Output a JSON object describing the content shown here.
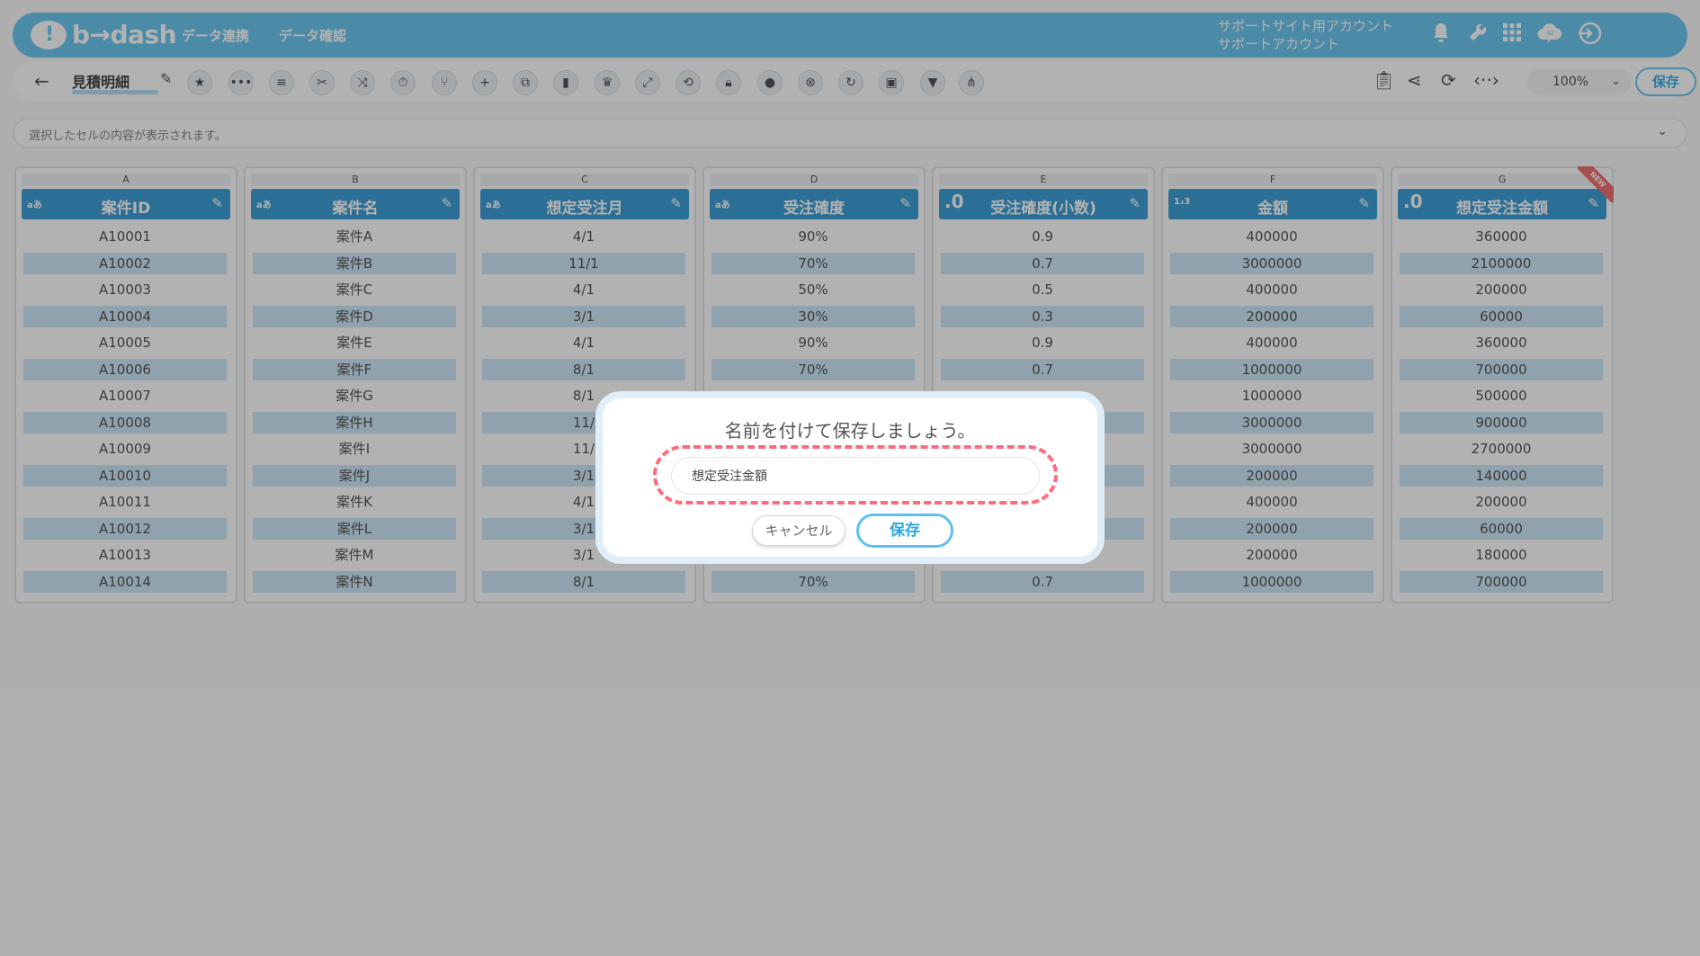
{
  "header": {
    "logo_text": "b→dash",
    "nav": [
      "データ連携",
      "データ確認"
    ],
    "account_line1": "サポートサイト用アカウント",
    "account_line2": "サポートアカウント",
    "icons": [
      "bell-icon",
      "wrench-icon",
      "grid-icon",
      "cloud-icon",
      "logout-icon"
    ],
    "cloud_badge": "32",
    "accent": "#6ec8ef"
  },
  "toolbar": {
    "back": "←",
    "sheet_title": "見積明細",
    "zoom": "100%",
    "save_label": "保存"
  },
  "cellbar": {
    "placeholder": "選択したセルの内容が表示されます。"
  },
  "columns": [
    {
      "letter": "A",
      "type": "aあ",
      "name": "案件ID",
      "values": [
        "A10001",
        "A10002",
        "A10003",
        "A10004",
        "A10005",
        "A10006",
        "A10007",
        "A10008",
        "A10009",
        "A10010",
        "A10011",
        "A10012",
        "A10013",
        "A10014"
      ]
    },
    {
      "letter": "B",
      "type": "aあ",
      "name": "案件名",
      "values": [
        "案件A",
        "案件B",
        "案件C",
        "案件D",
        "案件E",
        "案件F",
        "案件G",
        "案件H",
        "案件I",
        "案件J",
        "案件K",
        "案件L",
        "案件M",
        "案件N"
      ]
    },
    {
      "letter": "C",
      "type": "aあ",
      "name": "想定受注月",
      "values": [
        "4/1",
        "11/1",
        "4/1",
        "3/1",
        "4/1",
        "8/1",
        "8/1",
        "11/",
        "11/",
        "3/1",
        "4/1",
        "3/1",
        "3/1",
        "8/1"
      ]
    },
    {
      "letter": "D",
      "type": "aあ",
      "name": "受注確度",
      "values": [
        "90%",
        "70%",
        "50%",
        "30%",
        "90%",
        "70%",
        "",
        "",
        "",
        "",
        "",
        "",
        "",
        "70%"
      ]
    },
    {
      "letter": "E",
      "type": ".0",
      "name": "受注確度(小数)",
      "values": [
        "0.9",
        "0.7",
        "0.5",
        "0.3",
        "0.9",
        "0.7",
        "",
        "",
        "",
        "",
        "",
        "",
        "",
        "0.7"
      ]
    },
    {
      "letter": "F",
      "type": "1₂3",
      "name": "金額",
      "values": [
        "400000",
        "3000000",
        "400000",
        "200000",
        "400000",
        "1000000",
        "1000000",
        "3000000",
        "3000000",
        "200000",
        "400000",
        "200000",
        "200000",
        "1000000"
      ]
    },
    {
      "letter": "G",
      "type": ".0",
      "name": "想定受注金額",
      "values": [
        "360000",
        "2100000",
        "200000",
        "60000",
        "360000",
        "700000",
        "500000",
        "900000",
        "2700000",
        "140000",
        "200000",
        "60000",
        "180000",
        "700000"
      ],
      "badge": "NEW"
    }
  ],
  "dialog": {
    "title": "名前を付けて保存しましょう。",
    "input_value": "想定受注金額",
    "cancel_label": "キャンセル",
    "save_label": "保存"
  }
}
